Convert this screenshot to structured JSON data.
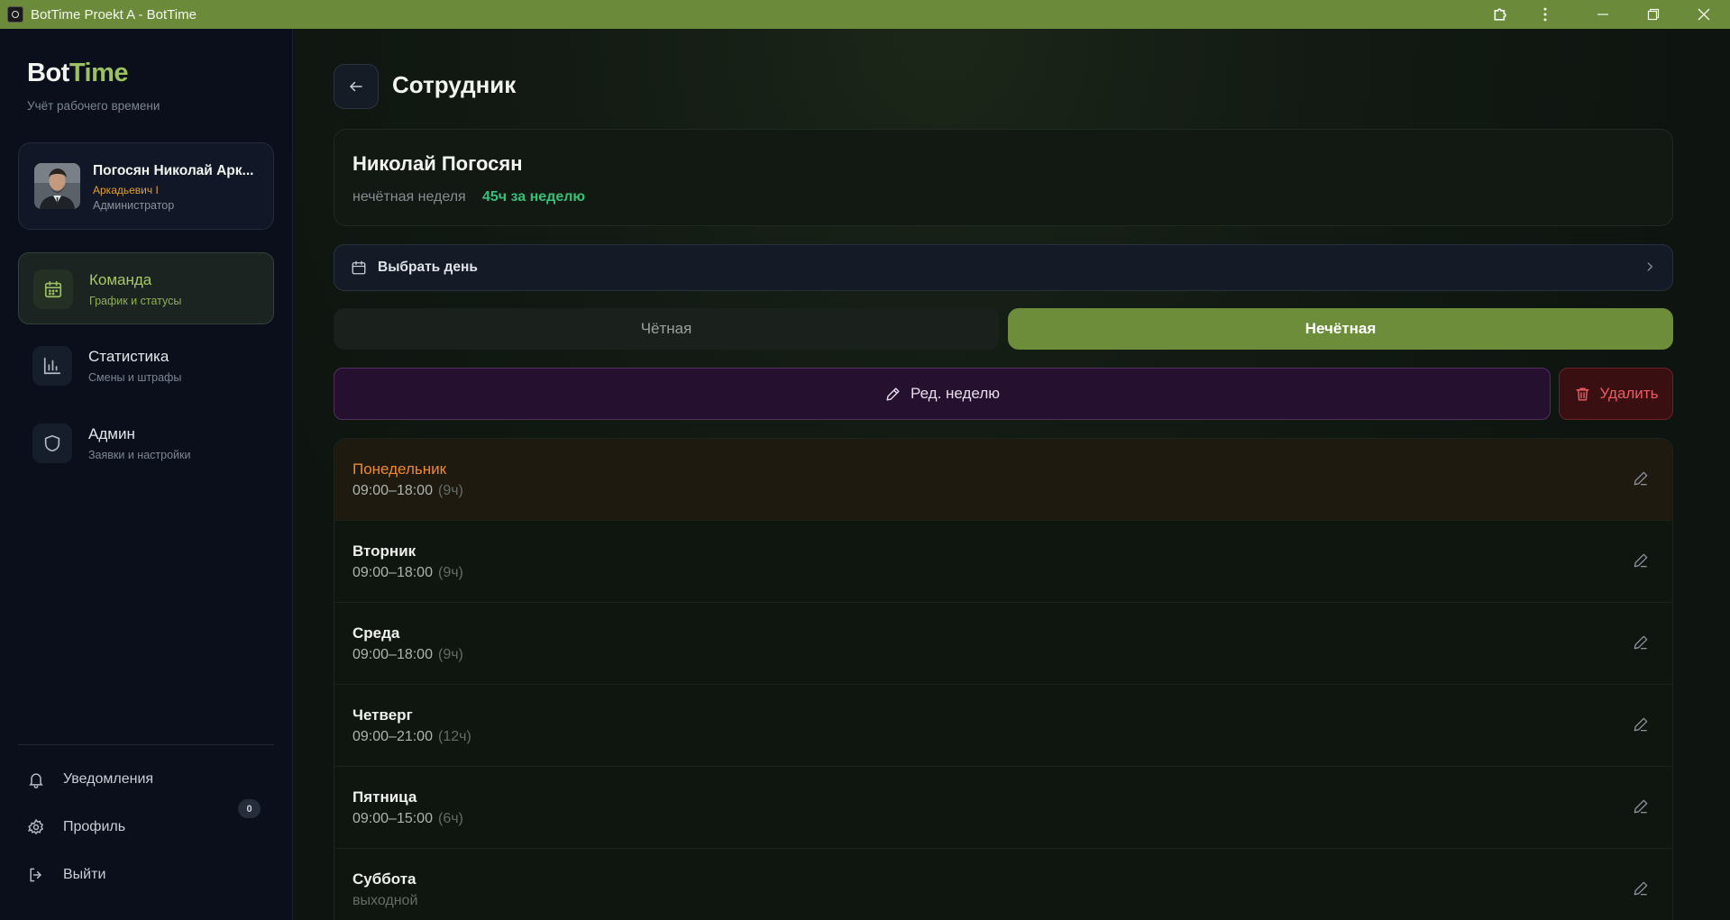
{
  "window": {
    "title": "BotTime Proekt A - BotTime"
  },
  "brand": {
    "logo_part1": "Bot",
    "logo_part2": "Time",
    "tagline": "Учёт рабочего времени"
  },
  "user": {
    "name": "Погосян Николай Арк...",
    "patronymic": "Аркадьевич I",
    "role": "Администратор"
  },
  "nav": [
    {
      "title": "Команда",
      "subtitle": "График и статусы",
      "icon": "calendar-icon",
      "active": true
    },
    {
      "title": "Статистика",
      "subtitle": "Смены и штрафы",
      "icon": "bar-chart-icon",
      "active": false
    },
    {
      "title": "Админ",
      "subtitle": "Заявки и настройки",
      "icon": "shield-icon",
      "active": false
    }
  ],
  "bottom_nav": {
    "notifications": "Уведомления",
    "notifications_count": "0",
    "profile": "Профиль",
    "logout": "Выйти"
  },
  "page": {
    "title": "Сотрудник"
  },
  "employee": {
    "name": "Николай Погосян",
    "week_type": "нечётная неделя",
    "hours": "45ч за неделю"
  },
  "day_picker": {
    "label": "Выбрать день"
  },
  "tabs": {
    "even": "Чётная",
    "odd": "Нечётная",
    "selected": "odd"
  },
  "actions": {
    "edit_week": "Ред. неделю",
    "delete": "Удалить"
  },
  "days": [
    {
      "name": "Понедельник",
      "time": "09:00–18:00",
      "duration": "(9ч)",
      "today": true
    },
    {
      "name": "Вторник",
      "time": "09:00–18:00",
      "duration": "(9ч)",
      "today": false
    },
    {
      "name": "Среда",
      "time": "09:00–18:00",
      "duration": "(9ч)",
      "today": false
    },
    {
      "name": "Четверг",
      "time": "09:00–21:00",
      "duration": "(12ч)",
      "today": false
    },
    {
      "name": "Пятница",
      "time": "09:00–15:00",
      "duration": "(6ч)",
      "today": false
    },
    {
      "name": "Суббота",
      "time": "выходной",
      "duration": "",
      "today": false
    }
  ],
  "colors": {
    "titlebar": "#6b8b3a",
    "accent_green": "#9bbf62",
    "hours_green": "#36c07a",
    "today_orange": "#ef8a2c",
    "danger": "#ef5b62"
  }
}
